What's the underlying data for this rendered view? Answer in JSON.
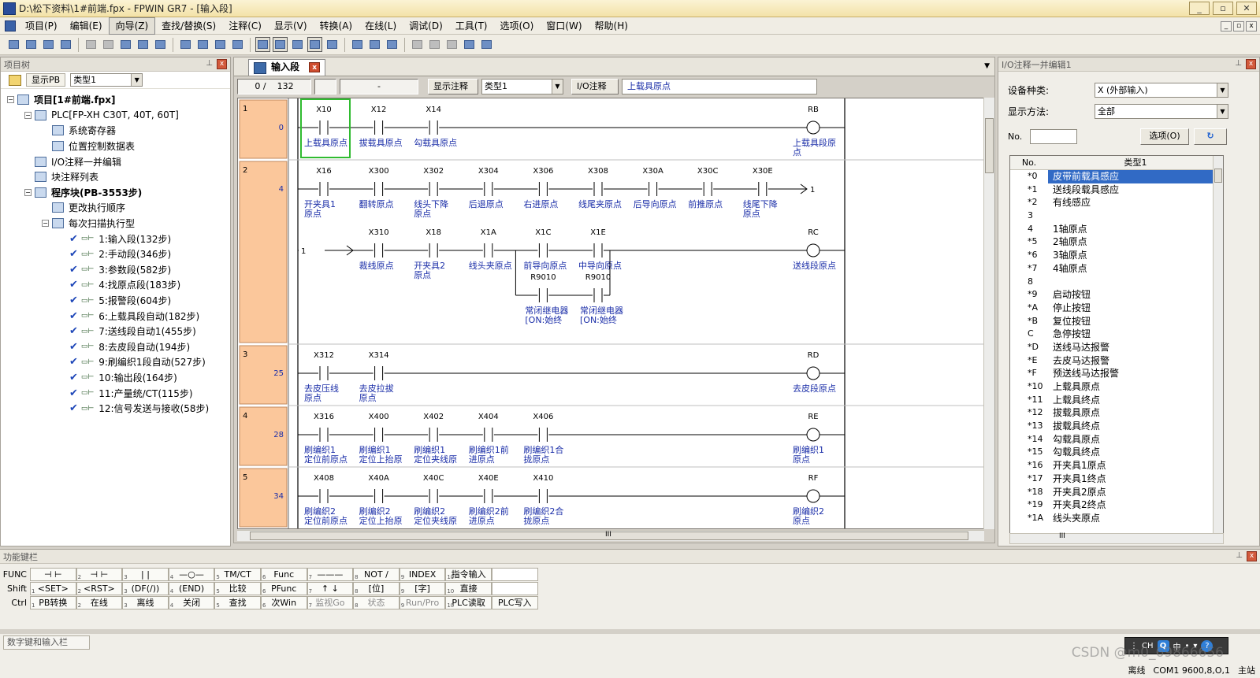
{
  "window": {
    "title": "D:\\松下资料\\1#前端.fpx - FPWIN GR7 - [输入段]",
    "buttons": [
      "_",
      "▫",
      "✕"
    ]
  },
  "menu": [
    "项目(P)",
    "编辑(E)",
    "向导(Z)",
    "查找/替换(S)",
    "注释(C)",
    "显示(V)",
    "转换(A)",
    "在线(L)",
    "调试(D)",
    "工具(T)",
    "选项(O)",
    "窗口(W)",
    "帮助(H)"
  ],
  "menu_selected_index": 2,
  "toolbar_icons": [
    "new-icon",
    "open-icon",
    "save-icon",
    "print-icon",
    "undo-icon",
    "redo-icon",
    "cut-icon",
    "copy-icon",
    "paste-icon",
    "block-icon",
    "delete-icon",
    "replace-icon",
    "find-icon",
    "ladder-mode-icon",
    "list-mode-icon",
    "boolean-icon",
    "monitor-icon",
    "convert-icon",
    "transfer-icon",
    "upload-icon",
    "download-icon",
    "status-icon",
    "run-icon",
    "run-prog-icon",
    "comment-icon",
    "dropdown-icon"
  ],
  "project_tree": {
    "header": "项目树",
    "btn_pb": "显示PB",
    "type_select": "类型1",
    "nodes": [
      {
        "level": 0,
        "exp": "−",
        "label": "项目[1#前端.fpx]",
        "bold": true
      },
      {
        "level": 1,
        "exp": "−",
        "label": "PLC[FP-XH C30T, 40T, 60T]"
      },
      {
        "level": 2,
        "label": "系统寄存器"
      },
      {
        "level": 2,
        "label": "位置控制数据表"
      },
      {
        "level": 1,
        "label": "I/O注释一并编辑"
      },
      {
        "level": 1,
        "label": "块注释列表"
      },
      {
        "level": 1,
        "exp": "−",
        "label": "程序块(PB-3553步)",
        "bold": true
      },
      {
        "level": 2,
        "label": "更改执行顺序"
      },
      {
        "level": 2,
        "exp": "−",
        "label": "每次扫描执行型"
      },
      {
        "level": 3,
        "check": true,
        "label": "1:输入段(132步)"
      },
      {
        "level": 3,
        "check": true,
        "label": "2:手动段(346步)"
      },
      {
        "level": 3,
        "check": true,
        "label": "3:参数段(582步)"
      },
      {
        "level": 3,
        "check": true,
        "label": "4:找原点段(183步)"
      },
      {
        "level": 3,
        "check": true,
        "label": "5:报警段(604步)"
      },
      {
        "level": 3,
        "check": true,
        "label": "6:上载具段自动(182步)"
      },
      {
        "level": 3,
        "check": true,
        "label": "7:送线段自动1(455步)"
      },
      {
        "level": 3,
        "check": true,
        "label": "8:去皮段自动(194步)"
      },
      {
        "level": 3,
        "check": true,
        "label": "9:刷编织1段自动(527步)"
      },
      {
        "level": 3,
        "check": true,
        "label": "10:输出段(164步)"
      },
      {
        "level": 3,
        "check": true,
        "label": "11:产量统/CT(115步)"
      },
      {
        "level": 3,
        "check": true,
        "label": "12:信号发送与接收(58步)"
      }
    ]
  },
  "editor": {
    "tab": "输入段",
    "step_position": "0 /",
    "step_total": "132",
    "dash": "-",
    "show_comment": "显示注释",
    "comment_type": "类型1",
    "io_comment_label": "I/O注释",
    "io_comment_value": "上载具原点",
    "hscroll_mark": "III"
  },
  "ladder": {
    "rows": [
      {
        "no": "1",
        "step": "0",
        "lines": [
          {
            "contacts": [
              {
                "addr": "X10",
                "c": [
                  "上载具原点"
                ]
              },
              {
                "addr": "X12",
                "c": [
                  "拔载具原点"
                ]
              },
              {
                "addr": "X14",
                "c": [
                  "勾载具原点"
                ]
              }
            ],
            "coil": {
              "addr": "RB",
              "c": [
                "上载具段原",
                "点"
              ]
            }
          }
        ]
      },
      {
        "no": "2",
        "step": "4",
        "lines": [
          {
            "contacts": [
              {
                "addr": "X16",
                "c": [
                  "开夹具1",
                  "原点"
                ]
              },
              {
                "addr": "X300",
                "c": [
                  "翻转原点"
                ]
              },
              {
                "addr": "X302",
                "c": [
                  "线头下降",
                  "原点"
                ]
              },
              {
                "addr": "X304",
                "c": [
                  "后退原点"
                ]
              },
              {
                "addr": "X306",
                "c": [
                  "右进原点"
                ]
              },
              {
                "addr": "X308",
                "c": [
                  "线尾夹原点"
                ]
              },
              {
                "addr": "X30A",
                "c": [
                  "后导向原点"
                ]
              },
              {
                "addr": "X30C",
                "c": [
                  "前推原点"
                ]
              },
              {
                "addr": "X30E",
                "c": [
                  "线尾下降",
                  "原点"
                ]
              }
            ],
            "cont_out": "1"
          },
          {
            "cont_in": "1",
            "contacts": [
              {
                "addr": "X310",
                "c": [
                  "裁线原点"
                ]
              },
              {
                "addr": "X18",
                "c": [
                  "开夹具2",
                  "原点"
                ]
              },
              {
                "addr": "X1A",
                "c": [
                  "线头夹原点"
                ]
              },
              {
                "addr": "X1C",
                "c": [
                  "前导向原点"
                ]
              },
              {
                "addr": "X1E",
                "c": [
                  "中导向原点"
                ]
              }
            ],
            "coil": {
              "addr": "RC",
              "c": [
                "送线段原点"
              ]
            },
            "parallel": [
              {
                "addr": "R9010",
                "c": [
                  "常闭继电器",
                  "[ON:始终"
                ]
              },
              {
                "addr": "R9010",
                "c": [
                  "常闭继电器",
                  "[ON:始终"
                ]
              }
            ]
          }
        ]
      },
      {
        "no": "3",
        "step": "25",
        "lines": [
          {
            "contacts": [
              {
                "addr": "X312",
                "c": [
                  "去皮压线",
                  "原点"
                ]
              },
              {
                "addr": "X314",
                "c": [
                  "去皮拉拔",
                  "原点"
                ]
              }
            ],
            "coil": {
              "addr": "RD",
              "c": [
                "去皮段原点"
              ]
            }
          }
        ]
      },
      {
        "no": "4",
        "step": "28",
        "lines": [
          {
            "contacts": [
              {
                "addr": "X316",
                "c": [
                  "刷编织1",
                  "定位前原点"
                ]
              },
              {
                "addr": "X400",
                "c": [
                  "刷编织1",
                  "定位上抬原"
                ]
              },
              {
                "addr": "X402",
                "c": [
                  "刷编织1",
                  "定位夹线原"
                ]
              },
              {
                "addr": "X404",
                "c": [
                  "刷编织1前",
                  "进原点"
                ]
              },
              {
                "addr": "X406",
                "c": [
                  "刷编织1合",
                  "拢原点"
                ]
              }
            ],
            "coil": {
              "addr": "RE",
              "c": [
                "刷编织1",
                "原点"
              ]
            }
          }
        ]
      },
      {
        "no": "5",
        "step": "34",
        "lines": [
          {
            "contacts": [
              {
                "addr": "X408",
                "c": [
                  "刷编织2",
                  "定位前原点"
                ]
              },
              {
                "addr": "X40A",
                "c": [
                  "刷编织2",
                  "定位上抬原"
                ]
              },
              {
                "addr": "X40C",
                "c": [
                  "刷编织2",
                  "定位夹线原"
                ]
              },
              {
                "addr": "X40E",
                "c": [
                  "刷编织2前",
                  "进原点"
                ]
              },
              {
                "addr": "X410",
                "c": [
                  "刷编织2合",
                  "拢原点"
                ]
              }
            ],
            "coil": {
              "addr": "RF",
              "c": [
                "刷编织2",
                "原点"
              ]
            }
          }
        ]
      }
    ]
  },
  "io_comment_panel": {
    "header": "I/O注释一并编辑1",
    "device_label": "设备种类:",
    "device_value": "X (外部输入)",
    "display_label": "显示方法:",
    "display_value": "全部",
    "no_label": "No.",
    "options_btn": "选项(O)",
    "col_no": "No.",
    "col_type": "类型1",
    "hscroll_mark": "III",
    "rows": [
      {
        "no": "*0",
        "v": "皮带前载具感应",
        "sel": true
      },
      {
        "no": "*1",
        "v": "送线段载具感应"
      },
      {
        "no": "*2",
        "v": "有线感应"
      },
      {
        "no": "3",
        "v": ""
      },
      {
        "no": "4",
        "v": "1轴原点"
      },
      {
        "no": "*5",
        "v": "2轴原点"
      },
      {
        "no": "*6",
        "v": "3轴原点"
      },
      {
        "no": "*7",
        "v": "4轴原点"
      },
      {
        "no": "8",
        "v": ""
      },
      {
        "no": "*9",
        "v": "启动按钮"
      },
      {
        "no": "*A",
        "v": "停止按钮"
      },
      {
        "no": "*B",
        "v": "复位按钮"
      },
      {
        "no": "C",
        "v": "急停按钮"
      },
      {
        "no": "*D",
        "v": "送线马达报警"
      },
      {
        "no": "*E",
        "v": "去皮马达报警"
      },
      {
        "no": "*F",
        "v": "预送线马达报警"
      },
      {
        "no": "*10",
        "v": "上载具原点"
      },
      {
        "no": "*11",
        "v": "上载具终点"
      },
      {
        "no": "*12",
        "v": "拔载具原点"
      },
      {
        "no": "*13",
        "v": "拔载具终点"
      },
      {
        "no": "*14",
        "v": "勾载具原点"
      },
      {
        "no": "*15",
        "v": "勾载具终点"
      },
      {
        "no": "*16",
        "v": "开夹具1原点"
      },
      {
        "no": "*17",
        "v": "开夹具1终点"
      },
      {
        "no": "*18",
        "v": "开夹具2原点"
      },
      {
        "no": "*19",
        "v": "开夹具2终点"
      },
      {
        "no": "*1A",
        "v": "线头夹原点"
      }
    ]
  },
  "function_keys": {
    "header": "功能键栏",
    "rows": [
      {
        "label": "FUNC",
        "keys": [
          {
            "n": "",
            "t": "⊣ ⊢"
          },
          {
            "n": "2",
            "t": "⊣ ⊢"
          },
          {
            "n": "3",
            "t": "| |"
          },
          {
            "n": "4",
            "t": "—○—"
          },
          {
            "n": "5",
            "t": "TM/CT"
          },
          {
            "n": "6",
            "t": "Func"
          },
          {
            "n": "7",
            "t": "———"
          },
          {
            "n": "8",
            "t": "NOT /"
          },
          {
            "n": "9",
            "t": "INDEX"
          },
          {
            "n": "10",
            "t": "指令输入"
          },
          {
            "n": "",
            "t": "",
            "blank": true
          }
        ]
      },
      {
        "label": "Shift",
        "keys": [
          {
            "n": "1",
            "t": "<SET>"
          },
          {
            "n": "2",
            "t": "<RST>"
          },
          {
            "n": "3",
            "t": "(DF(/))"
          },
          {
            "n": "4",
            "t": "(END)"
          },
          {
            "n": "5",
            "t": "比较"
          },
          {
            "n": "6",
            "t": "PFunc"
          },
          {
            "n": "7",
            "t": "↑ ↓"
          },
          {
            "n": "8",
            "t": "[位]"
          },
          {
            "n": "9",
            "t": "[字]"
          },
          {
            "n": "10",
            "t": "直接"
          },
          {
            "n": "",
            "t": "",
            "blank": true
          }
        ]
      },
      {
        "label": "Ctrl",
        "keys": [
          {
            "n": "1",
            "t": "PB转换"
          },
          {
            "n": "2",
            "t": "在线"
          },
          {
            "n": "3",
            "t": "离线"
          },
          {
            "n": "4",
            "t": "关闭"
          },
          {
            "n": "5",
            "t": "查找"
          },
          {
            "n": "6",
            "t": "次Win"
          },
          {
            "n": "7",
            "t": "监视Go",
            "dim": true
          },
          {
            "n": "8",
            "t": "状态",
            "dim": true
          },
          {
            "n": "9",
            "t": "Run/Pro",
            "dim": true
          },
          {
            "n": "10",
            "t": "PLC读取"
          },
          {
            "n": "",
            "t": "PLC写入"
          }
        ]
      }
    ]
  },
  "statusbar": {
    "num_input": "数字键和输入栏",
    "offline": "离线",
    "com": "COM1 9600,8,O,1",
    "station": "主站",
    "ime": {
      "ch": "CH",
      "zh": "中"
    }
  },
  "watermark": "CSDN @m0_69866656",
  "colors": {
    "step_col": "#fbc79b",
    "comment_blue": "#1b2ea8",
    "select_green": "#2fbb2f",
    "select_blue": "#316ac5"
  }
}
